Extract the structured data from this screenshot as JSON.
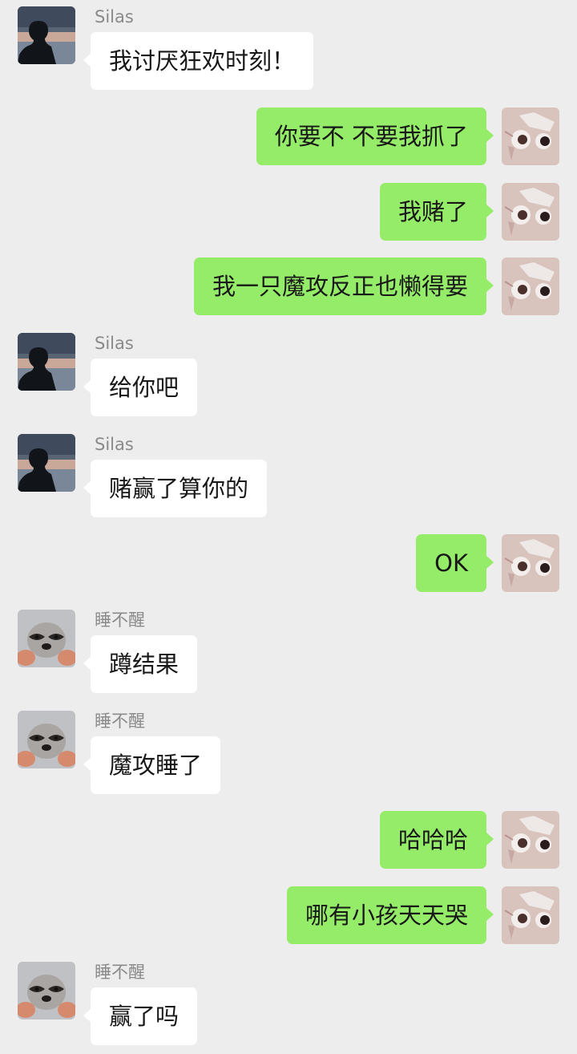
{
  "chat": {
    "messages": [
      {
        "side": "left",
        "sender": "Silas",
        "text": "我讨厌狂欢时刻！",
        "avatar": "silhouette-sunset-avatar"
      },
      {
        "side": "right",
        "text": "你要不 不要我抓了",
        "avatar": "cat-face-avatar"
      },
      {
        "side": "right",
        "text": "我赌了",
        "avatar": "cat-face-avatar"
      },
      {
        "side": "right",
        "text": "我一只魔攻反正也懒得要",
        "avatar": "cat-face-avatar"
      },
      {
        "side": "left",
        "sender": "Silas",
        "text": "给你吧",
        "avatar": "silhouette-sunset-avatar"
      },
      {
        "side": "left",
        "sender": "Silas",
        "text": "赌赢了算你的",
        "avatar": "silhouette-sunset-avatar"
      },
      {
        "side": "right",
        "text": "OK",
        "avatar": "cat-face-avatar"
      },
      {
        "side": "left",
        "sender": "睡不醒",
        "text": "蹲结果",
        "avatar": "raccoon-avatar"
      },
      {
        "side": "left",
        "sender": "睡不醒",
        "text": "魔攻睡了",
        "avatar": "raccoon-avatar"
      },
      {
        "side": "right",
        "text": "哈哈哈",
        "avatar": "cat-face-avatar"
      },
      {
        "side": "right",
        "text": "哪有小孩天天哭",
        "avatar": "cat-face-avatar"
      },
      {
        "side": "left",
        "sender": "睡不醒",
        "text": "赢了吗",
        "avatar": "raccoon-avatar"
      }
    ]
  },
  "colors": {
    "background": "#ededed",
    "incoming_bubble": "#ffffff",
    "outgoing_bubble": "#95ec69",
    "sender_name": "#8a8a8a",
    "message_text": "#181818"
  }
}
